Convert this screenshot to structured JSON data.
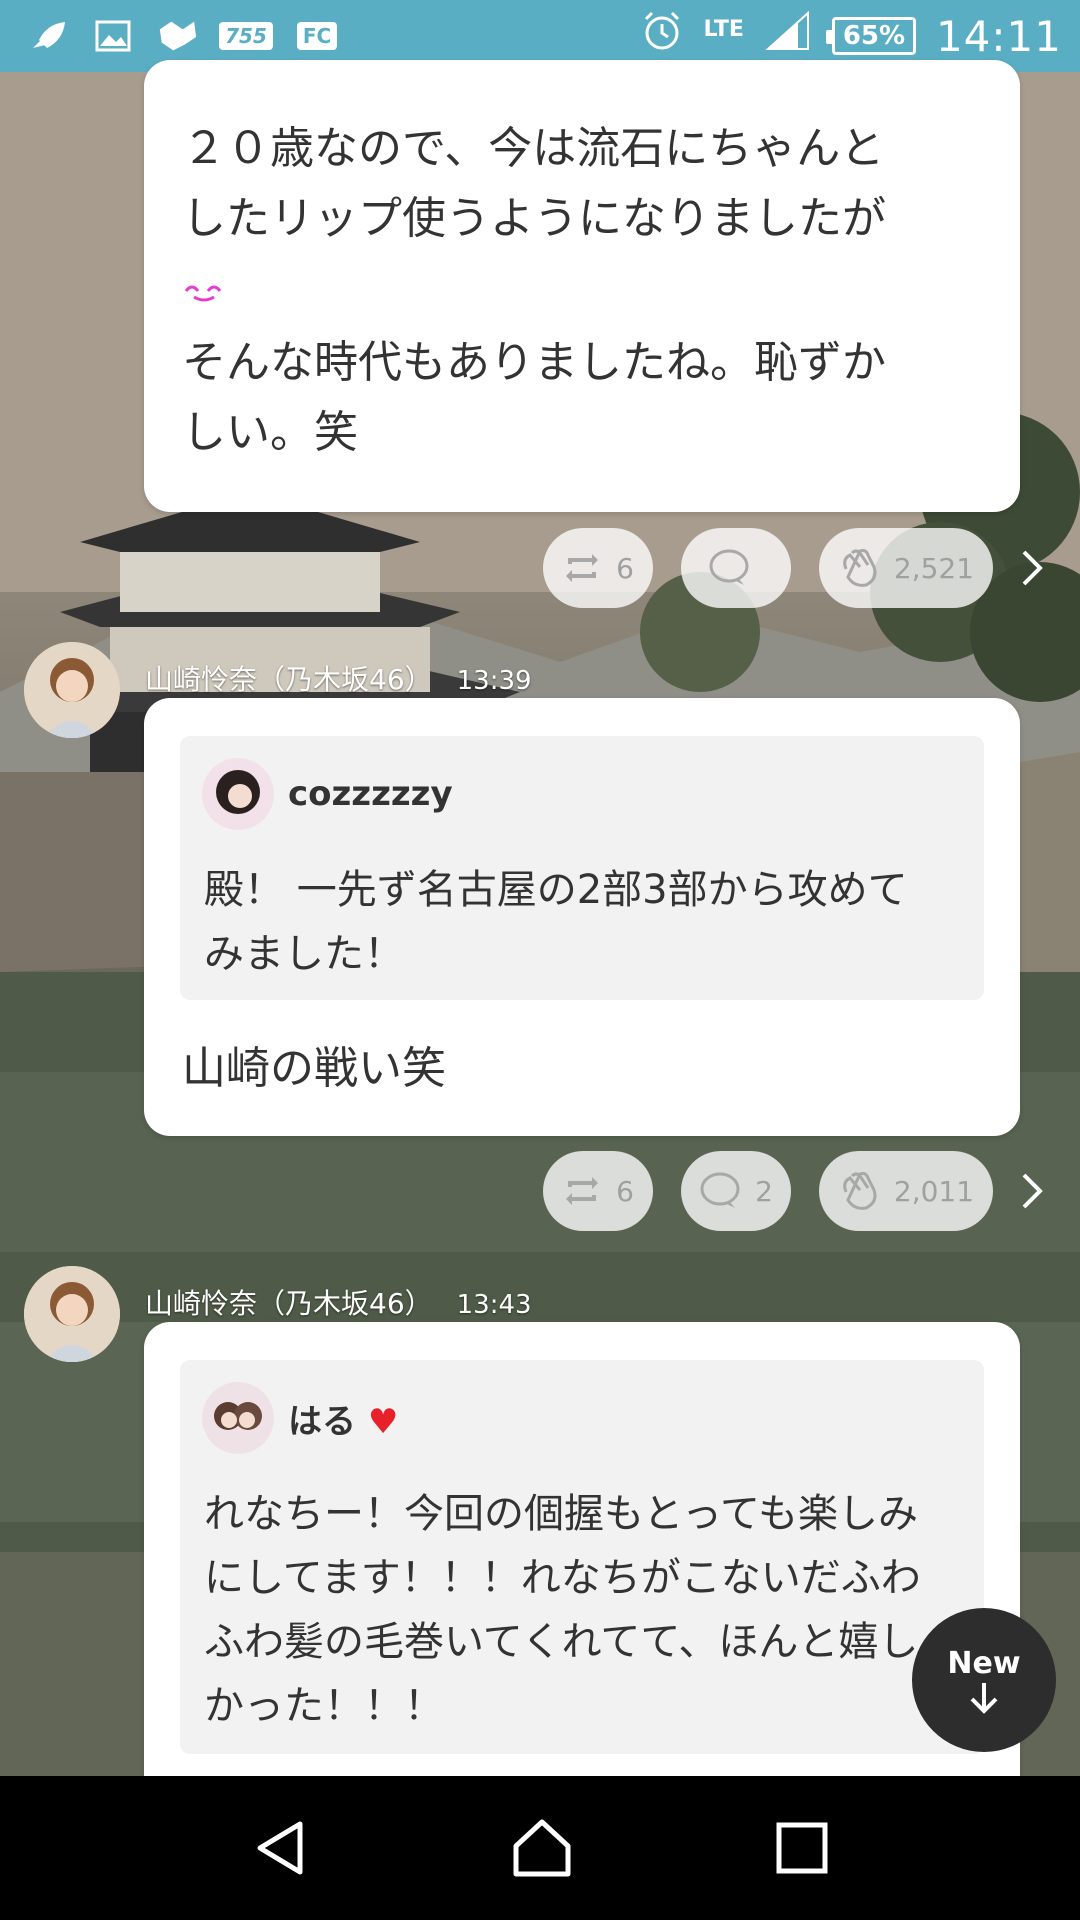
{
  "status_bar": {
    "lte": "LTE",
    "battery": "65%",
    "time": "14:11",
    "app_badge_1": "755",
    "app_badge_2": "FC"
  },
  "messages": [
    {
      "text_line1": "２０歳なので、今は流石にちゃんと",
      "text_line2": "したリップ使うようになりましたが",
      "text_line3": "そんな時代もありましたね。恥ずか",
      "text_line4": "しい。笑",
      "retweets": "6",
      "comments": "",
      "claps": "2,521"
    },
    {
      "author": "山崎怜奈（乃木坂46）",
      "time": "13:39",
      "quote_user": "cozzzzzy",
      "quote_line1": "殿！ 一先ず名古屋の2部3部から攻めて",
      "quote_line2": "みました！",
      "text": "山崎の戦い笑",
      "retweets": "6",
      "comments": "2",
      "claps": "2,011"
    },
    {
      "author": "山崎怜奈（乃木坂46）",
      "time": "13:43",
      "quote_user": "はる",
      "quote_line1": "れなちー！今回の個握もとっても楽しみ",
      "quote_line2": "にしてます！！！れなちがこないだふわ",
      "quote_line3": "ふわ髪の毛巻いてくれてて、ほんと嬉し",
      "quote_line4": "かった！！！"
    }
  ],
  "new_button": {
    "label": "New"
  },
  "colors": {
    "status_bar": "#5aaec4",
    "heart": "#e8202a"
  },
  "icons": [
    "rocket-icon",
    "image-icon",
    "puzzle-icon",
    "alarm-icon",
    "signal-icon",
    "retweet-icon",
    "comment-icon",
    "clap-icon",
    "chevron-right-icon",
    "arrow-down-icon",
    "back-icon",
    "home-icon",
    "recents-icon"
  ]
}
